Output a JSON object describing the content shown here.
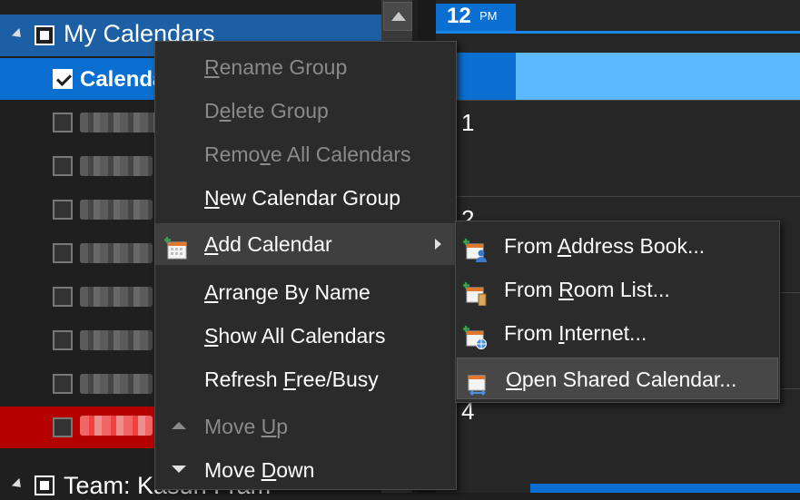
{
  "folder_pane": {
    "group_title": "My Calendars",
    "selected_calendar": "Calenda",
    "team_group": "Team: Kasun Fram"
  },
  "calendar_grid": {
    "hour_12": "12",
    "pm": "PM",
    "hour_1": "1",
    "hour_2": "2",
    "hour_4": "4"
  },
  "context_menu": {
    "items": [
      {
        "pre": "",
        "key": "R",
        "post": "ename Group",
        "enabled": false
      },
      {
        "pre": "D",
        "key": "e",
        "post": "lete Group",
        "enabled": false
      },
      {
        "pre": "Remo",
        "key": "v",
        "post": "e All Calendars",
        "enabled": false
      },
      {
        "pre": "",
        "key": "N",
        "post": "ew Calendar Group",
        "enabled": true
      },
      {
        "pre": "",
        "key": "A",
        "post": "dd Calendar",
        "enabled": true
      },
      {
        "pre": "",
        "key": "A",
        "post": "rrange By Name",
        "enabled": true
      },
      {
        "pre": "",
        "key": "S",
        "post": "how All Calendars",
        "enabled": true
      },
      {
        "pre": "Refresh ",
        "key": "F",
        "post": "ree/Busy",
        "enabled": true
      },
      {
        "pre": "Move ",
        "key": "U",
        "post": "p",
        "enabled": false
      },
      {
        "pre": "Move ",
        "key": "D",
        "post": "own",
        "enabled": true
      }
    ]
  },
  "submenu": {
    "items": [
      {
        "pre": "From ",
        "key": "A",
        "post": "ddress Book..."
      },
      {
        "pre": "From ",
        "key": "R",
        "post": "oom List..."
      },
      {
        "pre": "From ",
        "key": "I",
        "post": "nternet..."
      },
      {
        "pre": "",
        "key": "O",
        "post": "pen Shared Calendar..."
      }
    ]
  },
  "colors": {
    "accent": "#0a6fd0",
    "appointment": "#5cb8ff",
    "alert_row": "#b50000",
    "menu_bg": "#2b2b2b"
  }
}
